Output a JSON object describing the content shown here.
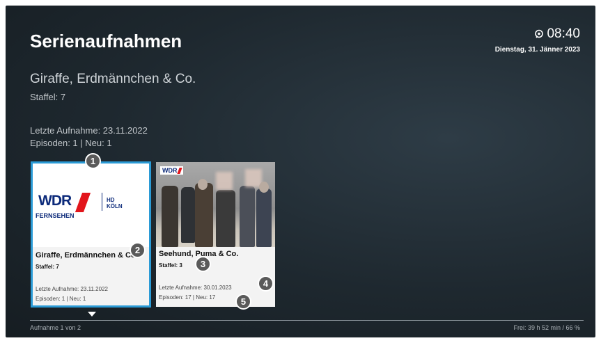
{
  "header": {
    "title": "Serienaufnahmen",
    "time": "08:40",
    "date": "Dienstag, 31. Jänner 2023",
    "recording_icon": "recording-icon"
  },
  "series": {
    "title": "Giraffe, Erdmännchen & Co.",
    "season": "Staffel: 7",
    "last_recording": "Letzte Aufnahme: 23.11.2022",
    "episodes": "Episoden: 1 | Neu: 1"
  },
  "cards": [
    {
      "name": "Giraffe, Erdmännchen & Co.",
      "season": "Staffel: 7",
      "last_recording": "Letzte Aufnahme: 23.11.2022",
      "episodes": "Episoden: 1 | Neu: 1",
      "channel_logo": "WDR",
      "channel_sub": "FERNSEHEN",
      "channel_hd": "HD",
      "channel_city": "KÖLN",
      "selected": true
    },
    {
      "name": "Seehund, Puma & Co.",
      "season": "Staffel: 3",
      "last_recording": "Letzte Aufnahme: 30.01.2023",
      "episodes": "Episoden: 17 | Neu: 17",
      "channel_logo": "WDR",
      "selected": false
    }
  ],
  "badges": [
    "1",
    "2",
    "3",
    "4",
    "5"
  ],
  "footer": {
    "position": "Aufnahme 1 von 2",
    "free_space": "Frei: 39 h 52 min / 66 %"
  },
  "colors": {
    "selection": "#2b9bd6",
    "wdr_blue": "#0c2a7a",
    "wdr_red": "#e2151b"
  }
}
